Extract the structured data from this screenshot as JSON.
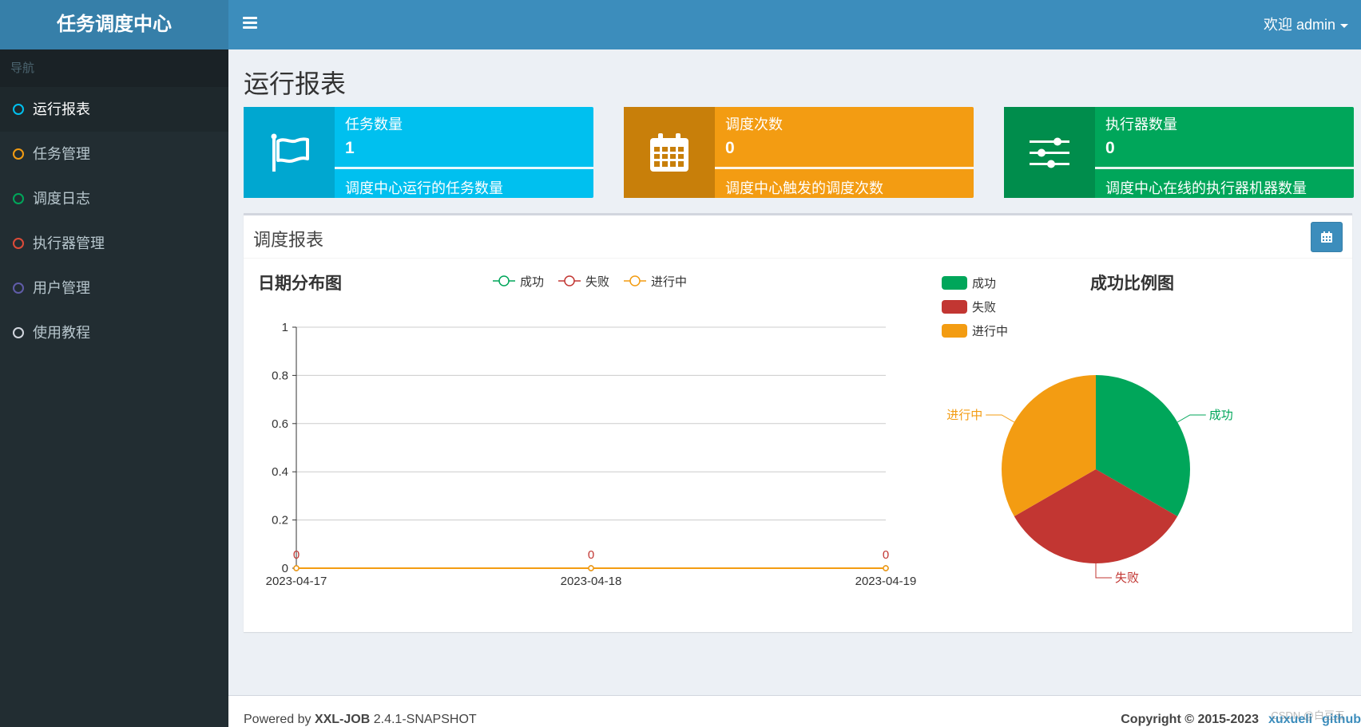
{
  "app": {
    "logo": "任务调度中心",
    "user_menu": "欢迎 admin"
  },
  "sidebar": {
    "header": "导航",
    "items": [
      {
        "label": "运行报表",
        "color": "#00c0ef",
        "active": true
      },
      {
        "label": "任务管理",
        "color": "#f39c12",
        "active": false
      },
      {
        "label": "调度日志",
        "color": "#00a65a",
        "active": false
      },
      {
        "label": "执行器管理",
        "color": "#dd4b39",
        "active": false
      },
      {
        "label": "用户管理",
        "color": "#605ca8",
        "active": false
      },
      {
        "label": "使用教程",
        "color": "#d2d6de",
        "active": false
      }
    ]
  },
  "main": {
    "title": "运行报表",
    "boxes": [
      {
        "title": "任务数量",
        "number": "1",
        "desc": "调度中心运行的任务数量",
        "icon": "flag-icon",
        "bg": "#00c0ef",
        "icon_bg": "#00a7d0"
      },
      {
        "title": "调度次数",
        "number": "0",
        "desc": "调度中心触发的调度次数",
        "icon": "calendar-icon",
        "bg": "#f39c12",
        "icon_bg": "#c87f0a"
      },
      {
        "title": "执行器数量",
        "number": "0",
        "desc": "调度中心在线的执行器机器数量",
        "icon": "sliders-icon",
        "bg": "#00a65a",
        "icon_bg": "#008d4c"
      }
    ],
    "report_title": "调度报表"
  },
  "chart_data": [
    {
      "type": "line",
      "title": "日期分布图",
      "x": [
        "2023-04-17",
        "2023-04-18",
        "2023-04-19"
      ],
      "series": [
        {
          "name": "成功",
          "values": [
            0,
            0,
            0
          ],
          "color": "#00a65a"
        },
        {
          "name": "失败",
          "values": [
            0,
            0,
            0
          ],
          "color": "#c23632"
        },
        {
          "name": "进行中",
          "values": [
            0,
            0,
            0
          ],
          "color": "#f39c12"
        }
      ],
      "ylim": [
        0,
        1
      ],
      "yticks": [
        "0",
        "0.2",
        "0.4",
        "0.6",
        "0.8",
        "1"
      ],
      "data_labels": [
        "0",
        "0",
        "0"
      ],
      "legend": "top",
      "grid": true
    },
    {
      "type": "pie",
      "title": "成功比例图",
      "slices": [
        {
          "name": "成功",
          "value": 1,
          "color": "#00a65a"
        },
        {
          "name": "失败",
          "value": 1,
          "color": "#c23632"
        },
        {
          "name": "进行中",
          "value": 1,
          "color": "#f39c12"
        }
      ],
      "legend": "top-left"
    }
  ],
  "footer": {
    "powered_prefix": "Powered by ",
    "brand": "XXL-JOB",
    "version": " 2.4.1-SNAPSHOT",
    "copyright": "Copyright © 2015-2023",
    "link1": "xuxueli",
    "link2": "github"
  },
  "watermark": "CSDN @白豆五"
}
